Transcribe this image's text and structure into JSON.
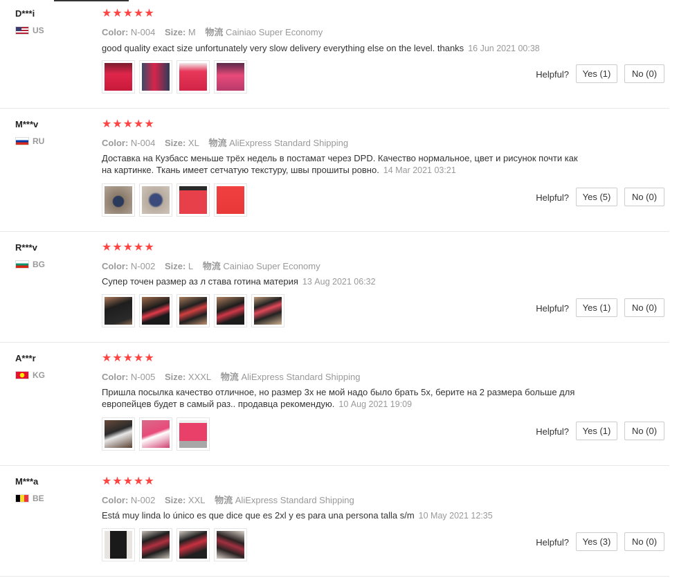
{
  "reviews": [
    {
      "user": "D***i",
      "country_code": "US",
      "stars": "★★★★★",
      "color_label": "Color:",
      "color": "N-004",
      "size_label": "Size:",
      "size": "M",
      "ship_label": "物流",
      "ship": "Cainiao Super Economy",
      "text": "good quality exact size unfortunately very slow delivery everything else on the level. thanks",
      "date": "16 Jun 2021 00:38",
      "helpful": "Helpful?",
      "yes": "Yes (1)",
      "no": "No (0)",
      "photos": 4
    },
    {
      "user": "M***v",
      "country_code": "RU",
      "stars": "★★★★★",
      "color_label": "Color:",
      "color": "N-004",
      "size_label": "Size:",
      "size": "XL",
      "ship_label": "物流",
      "ship": "AliExpress Standard Shipping",
      "text": "Доставка на Кузбасс меньше трёх недель в постамат через DPD. Качество нормальное, цвет и рисунок почти как на картинке. Ткань имеет сетчатую текстуру, швы прошиты ровно.",
      "date": "14 Mar 2021 03:21",
      "helpful": "Helpful?",
      "yes": "Yes (5)",
      "no": "No (0)",
      "photos": 4
    },
    {
      "user": "R***v",
      "country_code": "BG",
      "stars": "★★★★★",
      "color_label": "Color:",
      "color": "N-002",
      "size_label": "Size:",
      "size": "L",
      "ship_label": "物流",
      "ship": "Cainiao Super Economy",
      "text": "Супер точен размер аз л става готина материя",
      "date": "13 Aug 2021 06:32",
      "helpful": "Helpful?",
      "yes": "Yes (1)",
      "no": "No (0)",
      "photos": 5
    },
    {
      "user": "A***r",
      "country_code": "KG",
      "stars": "★★★★★",
      "color_label": "Color:",
      "color": "N-005",
      "size_label": "Size:",
      "size": "XXXL",
      "ship_label": "物流",
      "ship": "AliExpress Standard Shipping",
      "text": "Пришла посылка качество отличное, но размер 3х не мой надо было брать 5х, берите на 2 размера больше для европейцев будет в самый раз.. продавца рекомендую.",
      "date": "10 Aug 2021 19:09",
      "helpful": "Helpful?",
      "yes": "Yes (1)",
      "no": "No (0)",
      "photos": 3
    },
    {
      "user": "M***a",
      "country_code": "BE",
      "stars": "★★★★★",
      "color_label": "Color:",
      "color": "N-002",
      "size_label": "Size:",
      "size": "XXL",
      "ship_label": "物流",
      "ship": "AliExpress Standard Shipping",
      "text": "Está muy linda lo único es que dice que es 2xl y es para una persona talla s/m",
      "date": "10 May 2021 12:35",
      "helpful": "Helpful?",
      "yes": "Yes (3)",
      "no": "No (0)",
      "photos": 4
    }
  ],
  "colors": {
    "star": "#ff4747",
    "muted": "#999999"
  }
}
